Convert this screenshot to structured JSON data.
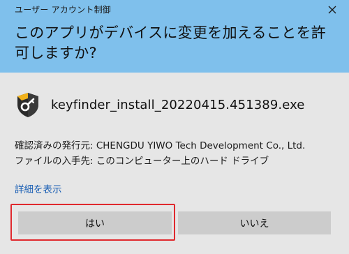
{
  "window": {
    "title": "ユーザー アカウント制御",
    "close_icon": "close-icon"
  },
  "prompt": {
    "question": "このアプリがデバイスに変更を加えることを許可しますか?"
  },
  "app": {
    "icon": "key-shield-icon",
    "name": "keyfinder_install_20220415.451389.exe"
  },
  "info": {
    "publisher": "確認済みの発行元: CHENGDU YIWO Tech Development Co., Ltd.",
    "origin": "ファイルの入手先: このコンピューター上のハード ドライブ"
  },
  "details_link": "詳細を表示",
  "buttons": {
    "yes": "はい",
    "no": "いいえ"
  },
  "colors": {
    "header_bg": "#7fc0ec",
    "body_bg": "#e6e6e6",
    "button_bg": "#cccccc",
    "link": "#1a5fb4",
    "highlight": "#e0292e"
  }
}
